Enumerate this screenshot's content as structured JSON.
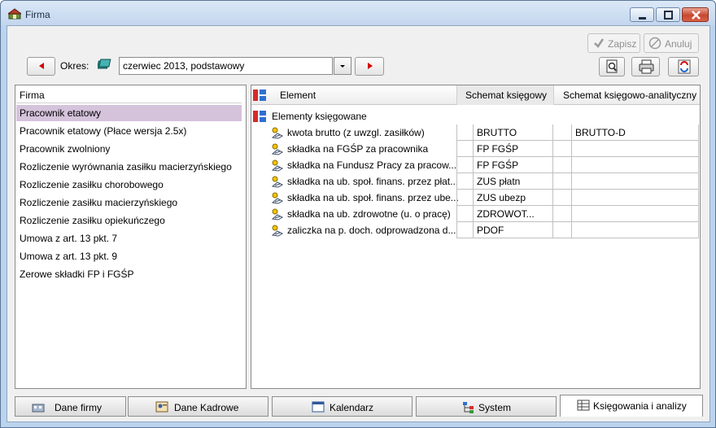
{
  "window": {
    "title": "Firma"
  },
  "toolbar": {
    "save_label": "Zapisz",
    "cancel_label": "Anuluj",
    "period_label": "Okres:",
    "period_value": "czerwiec 2013, podstawowy"
  },
  "left_list": {
    "items": [
      "Firma",
      "Pracownik etatowy",
      "Pracownik etatowy (Płace wersja 2.5x)",
      "Pracownik zwolniony",
      "Rozliczenie wyrównania zasiłku macierzyńskiego",
      "Rozliczenie zasiłku chorobowego",
      "Rozliczenie zasiłku macierzyńskiego",
      "Rozliczenie zasiłku opiekuńczego",
      "Umowa z art. 13 pkt. 7",
      "Umowa z art. 13 pkt. 9",
      "Zerowe składki FP i FGŚP"
    ],
    "selected_index": 1
  },
  "grid": {
    "columns": [
      "Element",
      "Schemat księgowy",
      "Schemat księgowo-analityczny"
    ],
    "group_label": "Elementy księgowane",
    "rows": [
      {
        "element": "kwota brutto (z uwzgl. zasiłków)",
        "schemat": "BRUTTO",
        "analityczny": "BRUTTO-D"
      },
      {
        "element": "składka na FGŚP za pracownika",
        "schemat": "FP FGŚP",
        "analityczny": ""
      },
      {
        "element": "składka na Fundusz Pracy za pracow...",
        "schemat": "FP FGŚP",
        "analityczny": ""
      },
      {
        "element": "składka na ub. społ. finans. przez płat...",
        "schemat": "ZUS płatn",
        "analityczny": ""
      },
      {
        "element": "składka na ub. społ. finans. przez ube...",
        "schemat": "ZUS ubezp",
        "analityczny": ""
      },
      {
        "element": "składka na ub. zdrowotne (u. o pracę)",
        "schemat": "ZDROWOT...",
        "analityczny": ""
      },
      {
        "element": "zaliczka na p. doch. odprowadzona d...",
        "schemat": "PDOF",
        "analityczny": ""
      }
    ]
  },
  "tabs": [
    {
      "label": "Dane firmy",
      "icon": "building-icon"
    },
    {
      "label": "Dane Kadrowe",
      "icon": "person-card-icon"
    },
    {
      "label": "Kalendarz",
      "icon": "calendar-icon"
    },
    {
      "label": "System",
      "icon": "system-tree-icon"
    },
    {
      "label": "Księgowania i analizy",
      "icon": "ledger-icon",
      "active": true
    }
  ],
  "colors": {
    "selection": "#d5c3dc",
    "nav_arrow": "#d40000",
    "title_bar": "#c3d6ee"
  }
}
